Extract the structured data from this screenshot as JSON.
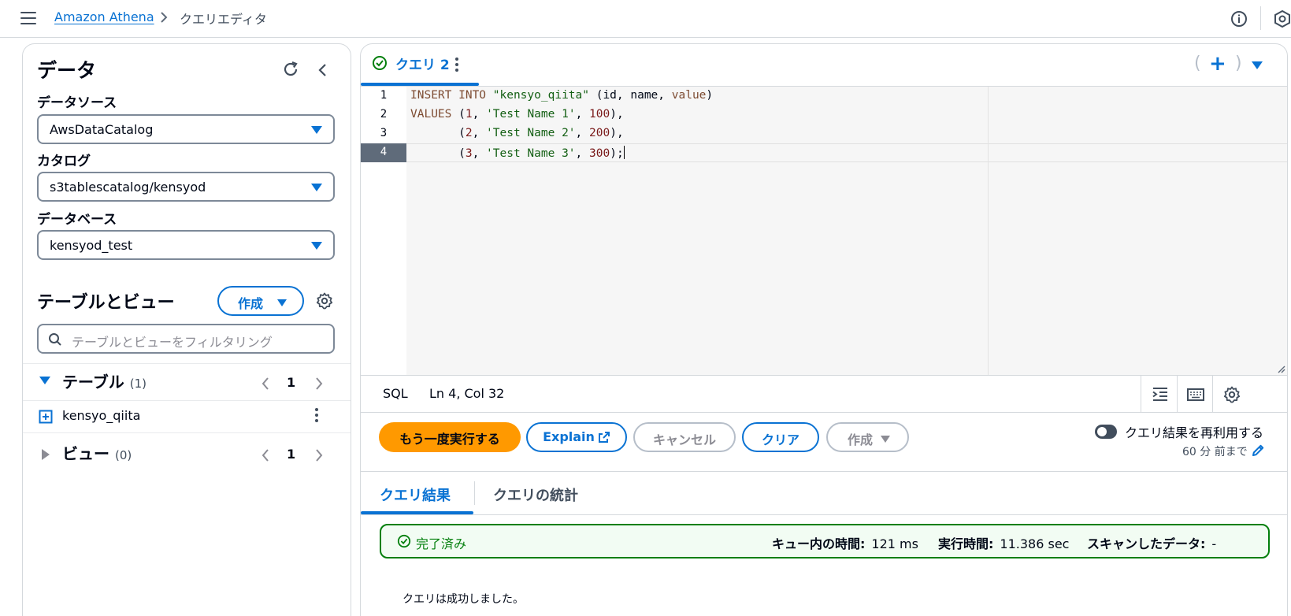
{
  "header": {
    "breadcrumb_root": "Amazon Athena",
    "breadcrumb_current": "クエリエディタ"
  },
  "sidebar": {
    "title": "データ",
    "data_source_label": "データソース",
    "data_source_value": "AwsDataCatalog",
    "catalog_label": "カタログ",
    "catalog_value": "s3tablescatalog/kensyod",
    "database_label": "データベース",
    "database_value": "kensyod_test",
    "tables_views_title": "テーブルとビュー",
    "create_label": "作成",
    "filter_placeholder": "テーブルとビューをフィルタリング",
    "tables_section": {
      "title": "テーブル",
      "count": "(1)",
      "page": "1"
    },
    "tables": [
      {
        "name": "kensyo_qiita"
      }
    ],
    "views_section": {
      "title": "ビュー",
      "count": "(0)",
      "page": "1"
    }
  },
  "editor": {
    "tab_label": "クエリ 2",
    "open_paren": "(",
    "close_paren": ")",
    "plus": "+",
    "line_numbers": [
      "1",
      "2",
      "3",
      "4"
    ],
    "lines": {
      "l1": {
        "kw1": "INSERT INTO",
        "str1": "\"kensyo_qiita\"",
        "t1": " (id, name, ",
        "kw2": "value",
        "t2": ")"
      },
      "l2": {
        "kw1": "VALUES",
        "t1": " (",
        "n1": "1",
        "t2": ", ",
        "s1": "'Test Name 1'",
        "t3": ", ",
        "n2": "100",
        "t4": "),"
      },
      "l3": {
        "t0": "       (",
        "n1": "2",
        "t2": ", ",
        "s1": "'Test Name 2'",
        "t3": ", ",
        "n2": "200",
        "t4": "),"
      },
      "l4": {
        "t0": "       (",
        "n1": "3",
        "t2": ", ",
        "s1": "'Test Name 3'",
        "t3": ", ",
        "n2": "300",
        "t4": ");"
      }
    },
    "language": "SQL",
    "cursor_position": "Ln 4, Col 32"
  },
  "actions": {
    "rerun": "もう一度実行する",
    "explain": "Explain",
    "cancel": "キャンセル",
    "clear": "クリア",
    "create": "作成",
    "reuse_label": "クエリ結果を再利用する",
    "reuse_sub": "60 分 前まで"
  },
  "results": {
    "tab_results": "クエリ結果",
    "tab_stats": "クエリの統計",
    "status": "完了済み",
    "queue_label": "キュー内の時間:",
    "queue_value": "121 ms",
    "exec_label": "実行時間:",
    "exec_value": "11.386 sec",
    "scanned_label": "スキャンしたデータ:",
    "scanned_value": "-",
    "message": "クエリは成功しました。"
  },
  "colors": {
    "accent": "#0972d3",
    "primary_button": "#ff9900",
    "success": "#037f0c"
  }
}
